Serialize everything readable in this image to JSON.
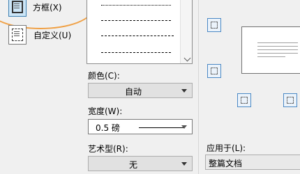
{
  "setting": {
    "box_label": "方框(X)",
    "custom_label": "自定义(U)"
  },
  "style": {
    "color_label": "颜色(C):",
    "color_value": "自动",
    "width_label": "宽度(W):",
    "width_value": "0.5  磅",
    "art_label": "艺术型(R):",
    "art_value": "无"
  },
  "preview": {
    "apply_label": "应用于(L):",
    "apply_value": "整篇文档"
  },
  "colors": {
    "annotation": "#f0a044",
    "selected_bg": "#cde6f7"
  }
}
